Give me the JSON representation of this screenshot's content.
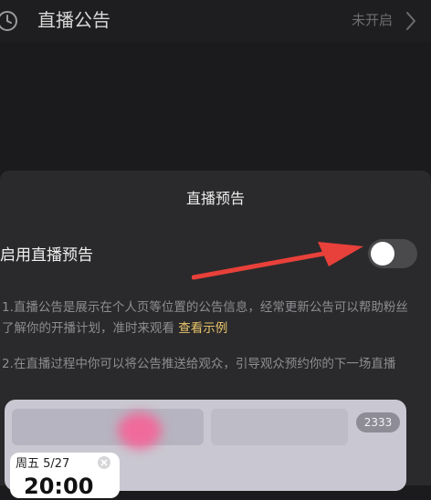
{
  "top": {
    "title": "直播公告",
    "status": "未开启",
    "icon": "clock-icon",
    "chevron": "chevron-right-icon"
  },
  "sheet": {
    "title": "直播预告",
    "toggle_label": "启用直播预告",
    "toggle_on": false,
    "desc1_text": "1.直播公告是展示在个人页等位置的公告信息，经常更新公告可以帮助粉丝了解你的开播计划，准时来观看",
    "desc1_link": "查看示例",
    "desc2_text": "2.在直播过程中你可以将公告推送给观众，引导观众预约你的下一场直播"
  },
  "preview": {
    "count": "2333",
    "date": "周五 5/27",
    "time": "20:00"
  },
  "colors": {
    "background": "#1b1b1d",
    "sheet": "#2a2a2c",
    "link": "#e9c46a",
    "arrow": "#e8403a",
    "pink_accent": "#f06a9a"
  }
}
